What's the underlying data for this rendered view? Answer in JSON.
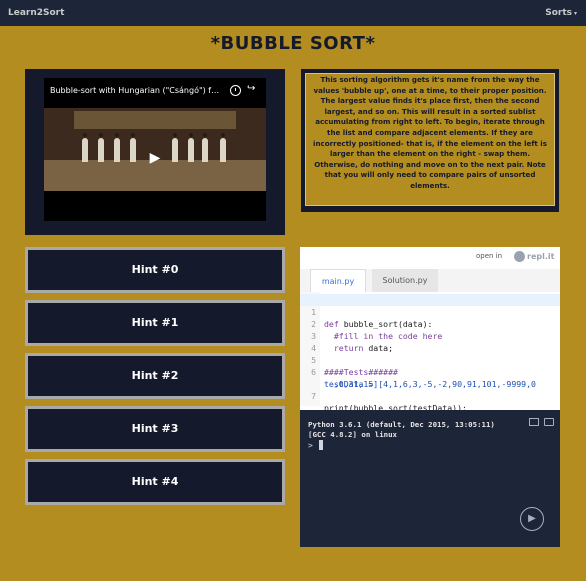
{
  "navbar": {
    "brand": "Learn2Sort",
    "menu_label": "Sorts",
    "menu_caret": "▾"
  },
  "page_title": "*BUBBLE SORT*",
  "video": {
    "title": "Bubble-sort with Hungarian (\"Csángó\") fo...",
    "clock_icon": "clock-icon",
    "share_icon": "↪",
    "play_icon": "▶"
  },
  "description": "This sorting algorithm gets it's name from the way the values 'bubble up', one at a time, to their proper position. The largest value finds it's place first, then the second largest, and so on. This will result in a sorted sublist accumulating from right to left. To begin, iterate through the list and compare adjacent elements. If they are incorrectly positioned- that is, if the element on the left is larger than the element on the right - swap them. Otherwise, do nothing and move on to the next pair. Note that you will only need to compare pairs of unsorted elements.",
  "hints": [
    "Hint #0",
    "Hint #1",
    "Hint #2",
    "Hint #3",
    "Hint #4"
  ],
  "repl": {
    "open_in": "open in",
    "logo_text": "repl.it",
    "tabs": [
      "main.py",
      "Solution.py"
    ],
    "line_numbers": [
      "1",
      "2",
      "3",
      "4",
      "5",
      "6",
      "7"
    ],
    "code": {
      "l1_kw": "def",
      "l1_rest": " bubble_sort(data):",
      "l2": "  #fill in the code here",
      "l3_kw": "  return",
      "l3_rest": " data;",
      "l5": "####Tests######",
      "l6a": "testData = [4,1,6,3,-5,-2,90,91,101,-9999,0",
      "l6b": "  ,0,31,15]",
      "l7": "print(bubble_sort(testData));"
    },
    "console": {
      "line1": "Python 3.6.1 (default, Dec 2015, 13:05:11)",
      "line2": "[GCC 4.8.2] on linux",
      "prompt": ">",
      "run_icon": "▶"
    }
  },
  "colors": {
    "background": "#b38d1f",
    "panel": "#141a2b",
    "navbar": "#1d2638"
  }
}
